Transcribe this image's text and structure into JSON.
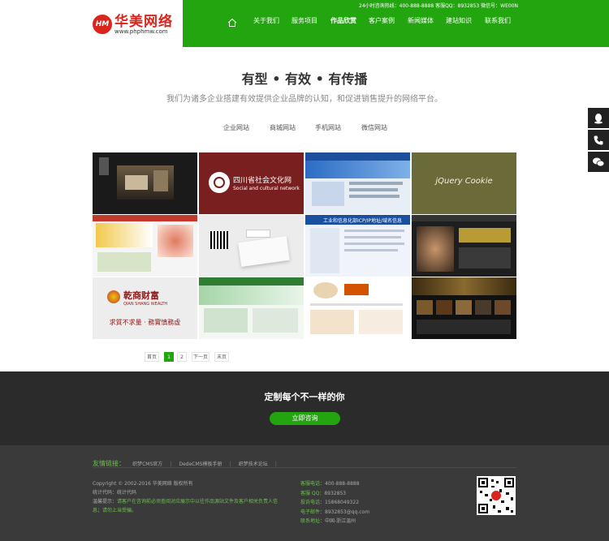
{
  "brand": {
    "badge": "HM",
    "name": "华美网络",
    "url": "www.phphmw.com"
  },
  "topline": "24小时咨询热线：400-888-8888 客服QQ：8932853 微信号：WE00N",
  "nav": {
    "home_icon": "home-icon",
    "items": [
      "关于我们",
      "服务项目",
      "作品欣赏",
      "客户案例",
      "新闻媒体",
      "建站知识",
      "联系我们"
    ],
    "active": "作品欣赏"
  },
  "section": {
    "slogan": "有型 • 有效 • 有传播",
    "subtitle": "我们为诸多企业搭建有效提供企业品牌的认知，和促进销售提升的网络平台。",
    "tabs": [
      "企业网站",
      "商城网站",
      "手机网站",
      "微信网站"
    ]
  },
  "portfolio": {
    "items": [
      {
        "name": "interior-design-site"
      },
      {
        "name": "sichuan-culture-site",
        "title": "四川省社会文化网",
        "subtitle": "Social and cultural network"
      },
      {
        "name": "enterprise-blue-site"
      },
      {
        "name": "jquery-cookie",
        "title": "jQuery Cookie"
      },
      {
        "name": "green-corporate-site"
      },
      {
        "name": "qr-brochure-site"
      },
      {
        "name": "icp-filing-site",
        "title": "工业和信息化部ICP/IP地址/域名信息"
      },
      {
        "name": "fitness-site"
      },
      {
        "name": "qian-shang-wealth",
        "title": "乾商财富",
        "subtitle": "QIAN SHANG WEALTH",
        "tagline": "求質不求量 · 務實慎務虛"
      },
      {
        "name": "green-portal-site"
      },
      {
        "name": "catering-site"
      },
      {
        "name": "dark-events-site"
      }
    ]
  },
  "pager": {
    "first": "首页",
    "pages": [
      "1",
      "2"
    ],
    "current": "1",
    "next": "下一页",
    "last": "末页"
  },
  "cta": {
    "title": "定制每个不一样的你",
    "button": "立即咨询"
  },
  "footer": {
    "friend_title": "友情链接：",
    "friend_links": [
      "织梦CMS官方",
      "DedeCMS模板手册",
      "织梦技术论坛"
    ],
    "copyright": "Copyright © 2002-2016 华美网络 版权所有",
    "stats": "统计代码：统计代码",
    "warn_label": "温馨提示：",
    "warn_text": "请客户在咨询前必须查阅对应展示中以往作品源站文件及客户相关负责人信息；请勿上当受骗。",
    "contacts": [
      {
        "k": "客服电话：",
        "v": "400-888-8888"
      },
      {
        "k": "客服 QQ：",
        "v": "8932853"
      },
      {
        "k": "投诉电话：",
        "v": "15868049322"
      },
      {
        "k": "电子邮件：",
        "v": "8932853@qq.com"
      },
      {
        "k": "联系地址：",
        "v": "中国-浙江温州"
      }
    ],
    "qr_icon": "qr-code-icon"
  },
  "side_tools": [
    "qq-icon",
    "phone-icon",
    "wechat-icon"
  ],
  "colors": {
    "brand_green": "#22a50e",
    "brand_red": "#d9251c",
    "dark_band": "#2b2b2b",
    "footer_bg": "#3a3a3a"
  }
}
